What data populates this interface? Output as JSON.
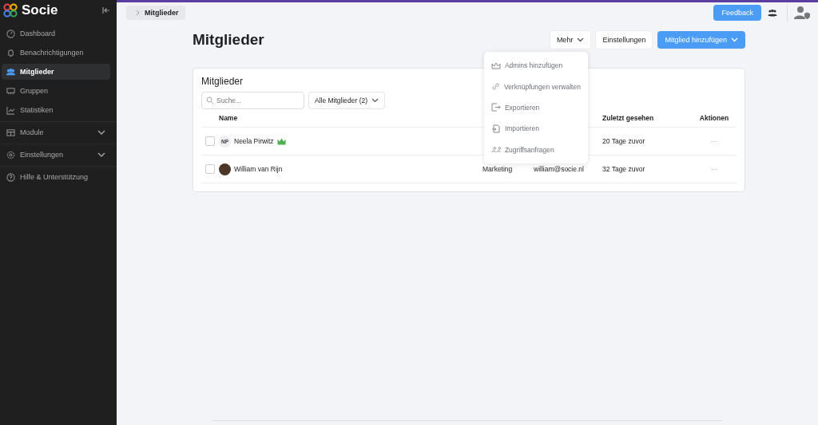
{
  "sidebar": {
    "brand": "Socie",
    "items": [
      {
        "label": "Dashboard",
        "selected": false,
        "expandable": false
      },
      {
        "label": "Benachrichtigungen",
        "selected": false,
        "expandable": false
      },
      {
        "label": "Mitglieder",
        "selected": true,
        "expandable": false
      },
      {
        "label": "Gruppen",
        "selected": false,
        "expandable": false
      },
      {
        "label": "Statistiken",
        "selected": false,
        "expandable": false
      },
      {
        "label": "Module",
        "selected": false,
        "expandable": true
      },
      {
        "label": "Einstellungen",
        "selected": false,
        "expandable": true
      },
      {
        "label": "Hilfe & Unterstützung",
        "selected": false,
        "expandable": false
      }
    ]
  },
  "breadcrumb": "Mitglieder",
  "topbar": {
    "feedback": "Feedback"
  },
  "page": {
    "title": "Mitglieder",
    "buttons": [
      {
        "label": "Mehr",
        "kind": "secondary",
        "caret": true
      },
      {
        "label": "Einstellungen",
        "kind": "secondary",
        "caret": false
      },
      {
        "label": "Mitglied hinzufügen",
        "kind": "primary",
        "caret": true
      }
    ]
  },
  "menu": {
    "items": [
      {
        "label": "Admins hinzufügen"
      },
      {
        "label": "Verknüpfungen verwalten"
      },
      {
        "label": "Exportieren"
      },
      {
        "label": "Importieren"
      },
      {
        "label": "Zugriffsanfragen"
      }
    ]
  },
  "card": {
    "title": "Mitglieder",
    "search": {
      "placeholder": "Suche..."
    },
    "filter": "Alle Mitglieder (2)",
    "columns": [
      "Name",
      "Zuletzt gesehen",
      "Aktionen"
    ],
    "rows": [
      {
        "name": "Neela Pirwitz",
        "initials": "NP",
        "admin": true,
        "last_seen": "20 Tage zuvor",
        "actions": "···",
        "checked": false
      },
      {
        "name": "William van Rijn",
        "admin": false,
        "column_2": "Marketing",
        "column_3": "william@socie.nl",
        "last_seen": "32 Tage zuvor",
        "actions": "···",
        "checked": false
      }
    ]
  }
}
